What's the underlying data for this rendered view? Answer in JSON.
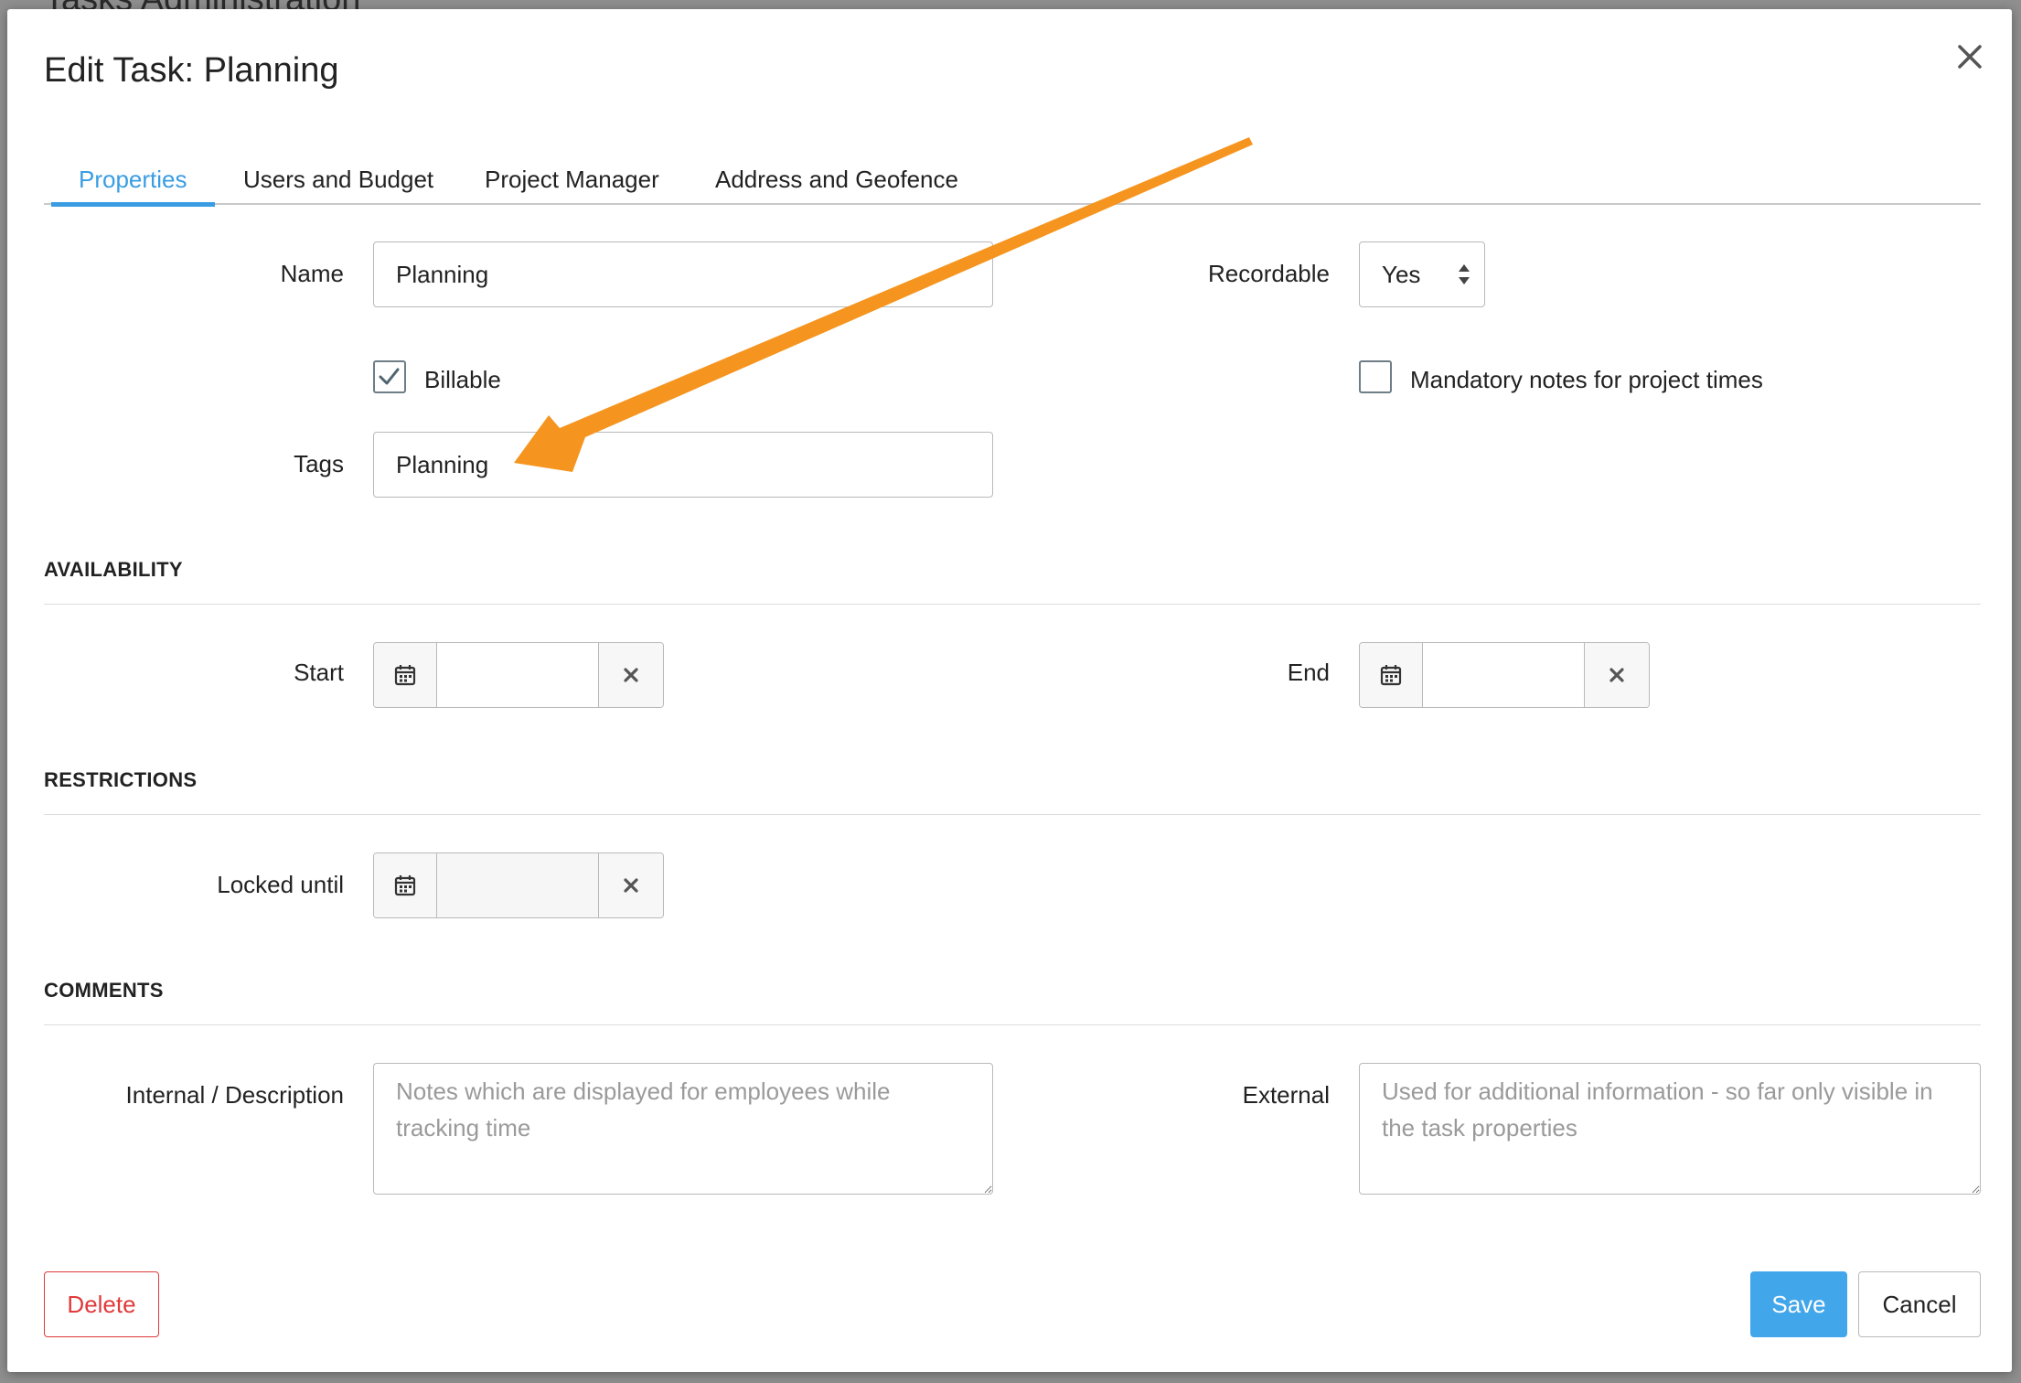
{
  "background": {
    "page_title": "Tasks Administration"
  },
  "dialog": {
    "title": "Edit Task: Planning",
    "close_icon": "close-icon"
  },
  "tabs": [
    {
      "label": "Properties",
      "active": true
    },
    {
      "label": "Users and Budget",
      "active": false
    },
    {
      "label": "Project Manager",
      "active": false
    },
    {
      "label": "Address and Geofence",
      "active": false
    }
  ],
  "properties": {
    "name_label": "Name",
    "name_value": "Planning",
    "recordable_label": "Recordable",
    "recordable_value": "Yes",
    "billable_label": "Billable",
    "billable_checked": true,
    "mandatory_notes_label": "Mandatory notes for project times",
    "mandatory_notes_checked": false,
    "tags_label": "Tags",
    "tags_value": "Planning"
  },
  "availability": {
    "section_title": "AVAILABILITY",
    "start_label": "Start",
    "start_value": "",
    "end_label": "End",
    "end_value": ""
  },
  "restrictions": {
    "section_title": "RESTRICTIONS",
    "locked_until_label": "Locked until",
    "locked_until_value": ""
  },
  "comments": {
    "section_title": "COMMENTS",
    "internal_label": "Internal / Description",
    "internal_placeholder": "Notes which are displayed for employees while tracking time",
    "external_label": "External",
    "external_placeholder": "Used for additional information - so far only visible in the task properties"
  },
  "footer": {
    "delete_label": "Delete",
    "save_label": "Save",
    "cancel_label": "Cancel"
  },
  "colors": {
    "accent": "#3a9de3",
    "save_button": "#42a6ea",
    "delete": "#e03a3a",
    "annotation_arrow": "#f5951f"
  }
}
